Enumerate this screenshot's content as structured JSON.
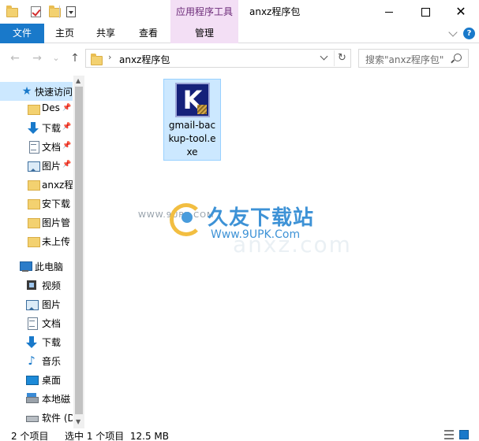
{
  "window": {
    "title": "anxz程序包",
    "contextual_tab": "应用程序工具",
    "minimize": "minimize-icon",
    "maximize": "maximize-icon",
    "close": "✕"
  },
  "ribbon": {
    "tabs": [
      {
        "label": "文件"
      },
      {
        "label": "主页"
      },
      {
        "label": "共享"
      },
      {
        "label": "查看"
      },
      {
        "label": "管理"
      }
    ],
    "help": "?"
  },
  "nav": {
    "back": "←",
    "forward": "→",
    "recent": "⌄",
    "up": "↑",
    "address_path": "anxz程序包",
    "chevron": "›",
    "refresh": "↻",
    "search_placeholder": "搜索\"anxz程序包\""
  },
  "sidebar": {
    "items": [
      {
        "label": "快速访问",
        "icon": "star-icon"
      },
      {
        "label": "Des",
        "icon": "folder-icon",
        "pinned": true
      },
      {
        "label": "下载",
        "icon": "download-icon",
        "pinned": true
      },
      {
        "label": "文档",
        "icon": "document-icon",
        "pinned": true
      },
      {
        "label": "图片",
        "icon": "pictures-icon",
        "pinned": true
      },
      {
        "label": "anxz程",
        "icon": "folder-icon"
      },
      {
        "label": "安下载",
        "icon": "folder-icon"
      },
      {
        "label": "图片管",
        "icon": "folder-icon"
      },
      {
        "label": "未上传",
        "icon": "folder-icon"
      },
      {
        "label": "此电脑",
        "icon": "computer-icon"
      },
      {
        "label": "视频",
        "icon": "video-icon"
      },
      {
        "label": "图片",
        "icon": "pictures-icon"
      },
      {
        "label": "文档",
        "icon": "document-icon"
      },
      {
        "label": "下载",
        "icon": "download-icon"
      },
      {
        "label": "音乐",
        "icon": "music-icon"
      },
      {
        "label": "桌面",
        "icon": "desktop-icon"
      },
      {
        "label": "本地磁",
        "icon": "disk-icon"
      },
      {
        "label": "软件 (D",
        "icon": "drive-icon"
      }
    ]
  },
  "content": {
    "files": [
      {
        "name": "gmail-backup-tool.exe",
        "name_lines": [
          "gmail-bac",
          "kup-tool.e",
          "xe"
        ],
        "icon_letter": "K",
        "selected": true
      }
    ]
  },
  "watermark": {
    "small": "WWW.9UPK.COM",
    "main": "久友下载站",
    "url": "Www.9UPK.Com",
    "ghost": "anxz.com"
  },
  "status": {
    "count": "2 个项目",
    "selection": "选中 1 个项目  12.5 MB"
  },
  "colors": {
    "accent": "#1979ca",
    "contextual": "#f3dff5",
    "selection": "#cce8ff"
  }
}
